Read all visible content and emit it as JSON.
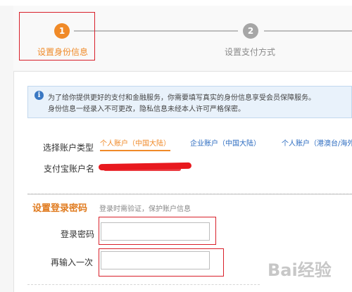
{
  "stepper": {
    "steps": [
      {
        "number": "1",
        "label": "设置身份信息",
        "state": "active"
      },
      {
        "number": "2",
        "label": "设置支付方式",
        "state": "inactive"
      }
    ]
  },
  "notice": {
    "icon": "info-icon",
    "line1": "为了给你提供更好的支付和金融服务，你需要填写真实的身份信息享受会员保障服务。",
    "line2": "身份信息一经录入不可更改，隐私信息未经本人许可严格保密。"
  },
  "account": {
    "type_label": "选择账户类型",
    "types": [
      {
        "label": "个人账户（中国大陆）",
        "selected": true
      },
      {
        "label": "企业账户（中国大陆）",
        "selected": false
      },
      {
        "label": "个人账户（港澳台/海外",
        "selected": false
      }
    ],
    "name_label": "支付宝账户名"
  },
  "password_section": {
    "title": "设置登录密码",
    "subtitle": "登录时需验证，保护账户信息",
    "password_label": "登录密码",
    "password_value": "",
    "confirm_label": "再输入一次",
    "confirm_value": ""
  },
  "colors": {
    "accent": "#f08a28",
    "link": "#2b6bc0",
    "annotation": "#d8202a",
    "notice_bg": "#e9f2fb"
  },
  "watermark": {
    "text": "Bai经验"
  }
}
